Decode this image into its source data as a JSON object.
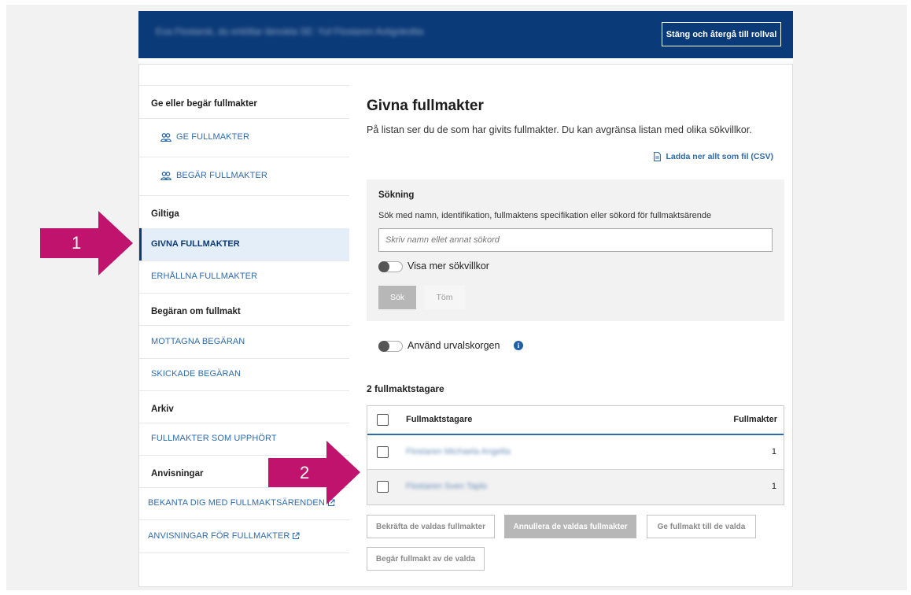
{
  "header": {
    "blurred_text": "Eva Flostarsk, du ertiöllar lämokla SE: Yuf Flostaren Avtignkoltia",
    "close_button": "Stäng och återgå till rollval"
  },
  "sidebar": {
    "sections": {
      "give_request": "Ge eller begär fullmakter",
      "valid": "Giltiga",
      "requests": "Begäran om fullmakt",
      "archive": "Arkiv",
      "guides": "Anvisningar"
    },
    "items": {
      "ge": "GE FULLMAKTER",
      "begar": "BEGÄR FULLMAKTER",
      "givna": "GIVNA FULLMAKTER",
      "erhallna": "ERHÅLLNA FULLMAKTER",
      "mottagna": "MOTTAGNA BEGÄRAN",
      "skickade": "SKICKADE BEGÄRAN",
      "upphort": "FULLMAKTER SOM UPPHÖRT",
      "bekanta": "BEKANTA DIG MED FULLMAKTSÄRENDEN",
      "anvisningar": "ANVISNINGAR FÖR FULLMAKTER"
    }
  },
  "main": {
    "title": "Givna fullmakter",
    "intro": "På listan ser du de som har givits fullmakter. Du kan avgränsa listan med olika sökvillkor.",
    "csv_link": "Ladda ner allt som fil (CSV)",
    "search": {
      "title": "Sökning",
      "description": "Sök med namn, identifikation, fullmaktens specifikation eller sökord för fullmaktsärende",
      "placeholder": "Skriv namn ellet annat sökord",
      "toggle_more": "Visa mer sökvillkor",
      "search_button": "Sök",
      "clear_button": "Töm"
    },
    "basket_toggle": "Använd urvalskorgen",
    "count_heading": "2 fullmaktstagare",
    "table": {
      "col_name": "Fullmaktstagare",
      "col_count": "Fullmakter",
      "rows": [
        {
          "name": "Flostaren Michaela Angelta",
          "count": "1"
        },
        {
          "name": "Flostaren Sven Taplo",
          "count": "1"
        }
      ]
    },
    "actions": {
      "confirm": "Bekräfta de valdas fullmakter",
      "cancel": "Annullera de valdas fullmakter",
      "give": "Ge fullmakt till de valda",
      "request": "Begär fullmakt av de valda"
    }
  },
  "callouts": {
    "one": "1",
    "two": "2",
    "color": "#c0136d"
  },
  "colors": {
    "brand": "#0b3a78",
    "link": "#2f6bab"
  }
}
